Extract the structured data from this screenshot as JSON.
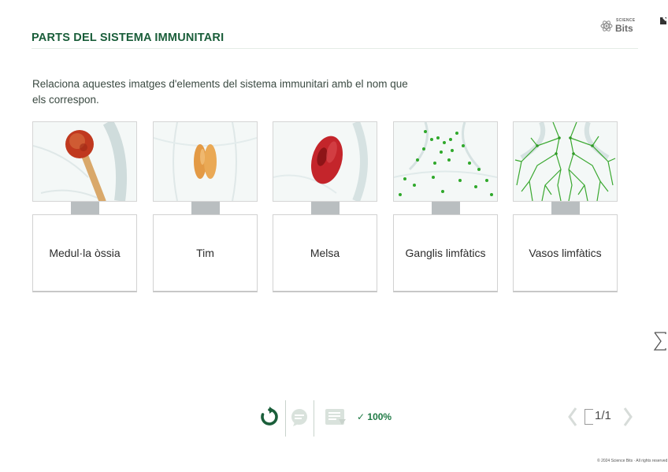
{
  "header": {
    "title": "PARTS DEL SISTEMA IMMUNITARI",
    "logo": {
      "small_text": "SCIENCE",
      "big_text": "Bits"
    }
  },
  "exercise": {
    "instructions": "Relaciona aquestes imatges d'elements del sistema immunitari amb el nom que els correspon.",
    "cards": [
      {
        "label": "Medul·la òssia",
        "image": "bone-marrow-illustration",
        "accent": "#c0391f"
      },
      {
        "label": "Tim",
        "image": "thymus-illustration",
        "accent": "#e8a24a"
      },
      {
        "label": "Melsa",
        "image": "spleen-illustration",
        "accent": "#c4252b"
      },
      {
        "label": "Ganglis limfàtics",
        "image": "lymph-nodes-illustration",
        "accent": "#2fa82b"
      },
      {
        "label": "Vasos limfàtics",
        "image": "lymph-vessels-illustration",
        "accent": "#3aa830"
      }
    ]
  },
  "toolbar": {
    "reset_icon": "circular-arrow-icon",
    "hint_icon": "speech-bubble-icon",
    "solution_icon": "notes-icon",
    "score_check": "✓",
    "score": "100%"
  },
  "pager": {
    "current": "1",
    "total": "/1"
  },
  "colors": {
    "brand": "#1a5e3a",
    "accent": "#1f7a45",
    "connector": "#b9bec0"
  },
  "footer": {
    "copyright": "© 2024 Science Bits · All rights reserved"
  }
}
